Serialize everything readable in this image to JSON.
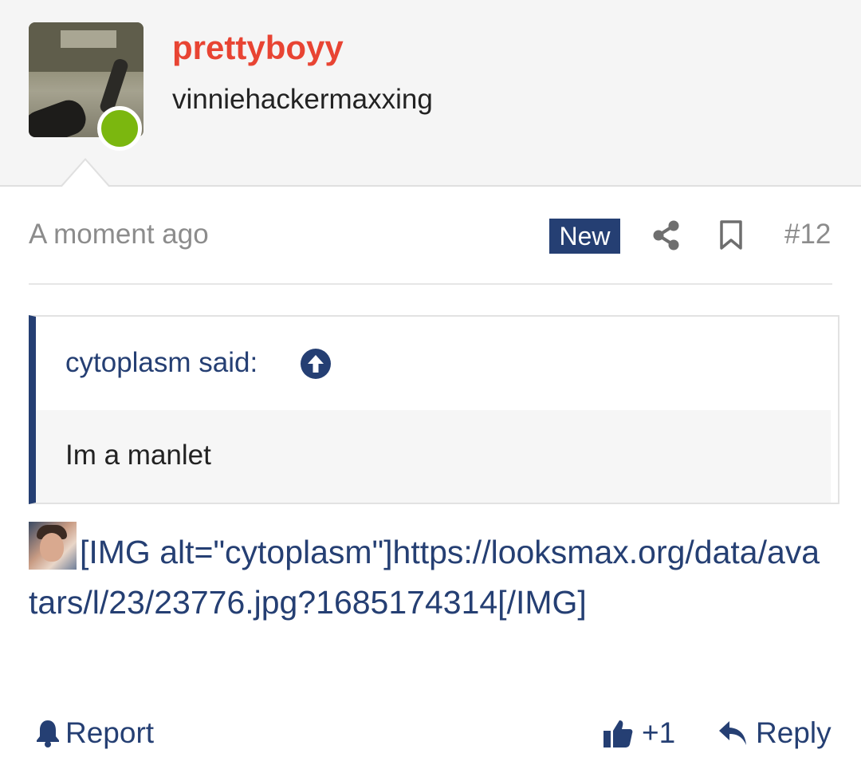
{
  "user": {
    "name": "prettyboyy",
    "title": "vinniehackermaxxing",
    "status": "online",
    "avatar_icon": "avatar-image",
    "name_color": "#e84433",
    "online_color": "#7bb70f"
  },
  "post": {
    "time": "A moment ago",
    "badge_new": "New",
    "number": "#12",
    "accent_color": "#253f73"
  },
  "quote": {
    "author": "cytoplasm said:",
    "text": "Im a manlet"
  },
  "content": {
    "img_text": "[IMG alt=\"cytoplasm\"]https://looksmax.org/data/avatars/l/23/23776.jpg?1685174314[/IMG]"
  },
  "actions": {
    "report": "Report",
    "like_count": "+1",
    "reply": "Reply"
  }
}
